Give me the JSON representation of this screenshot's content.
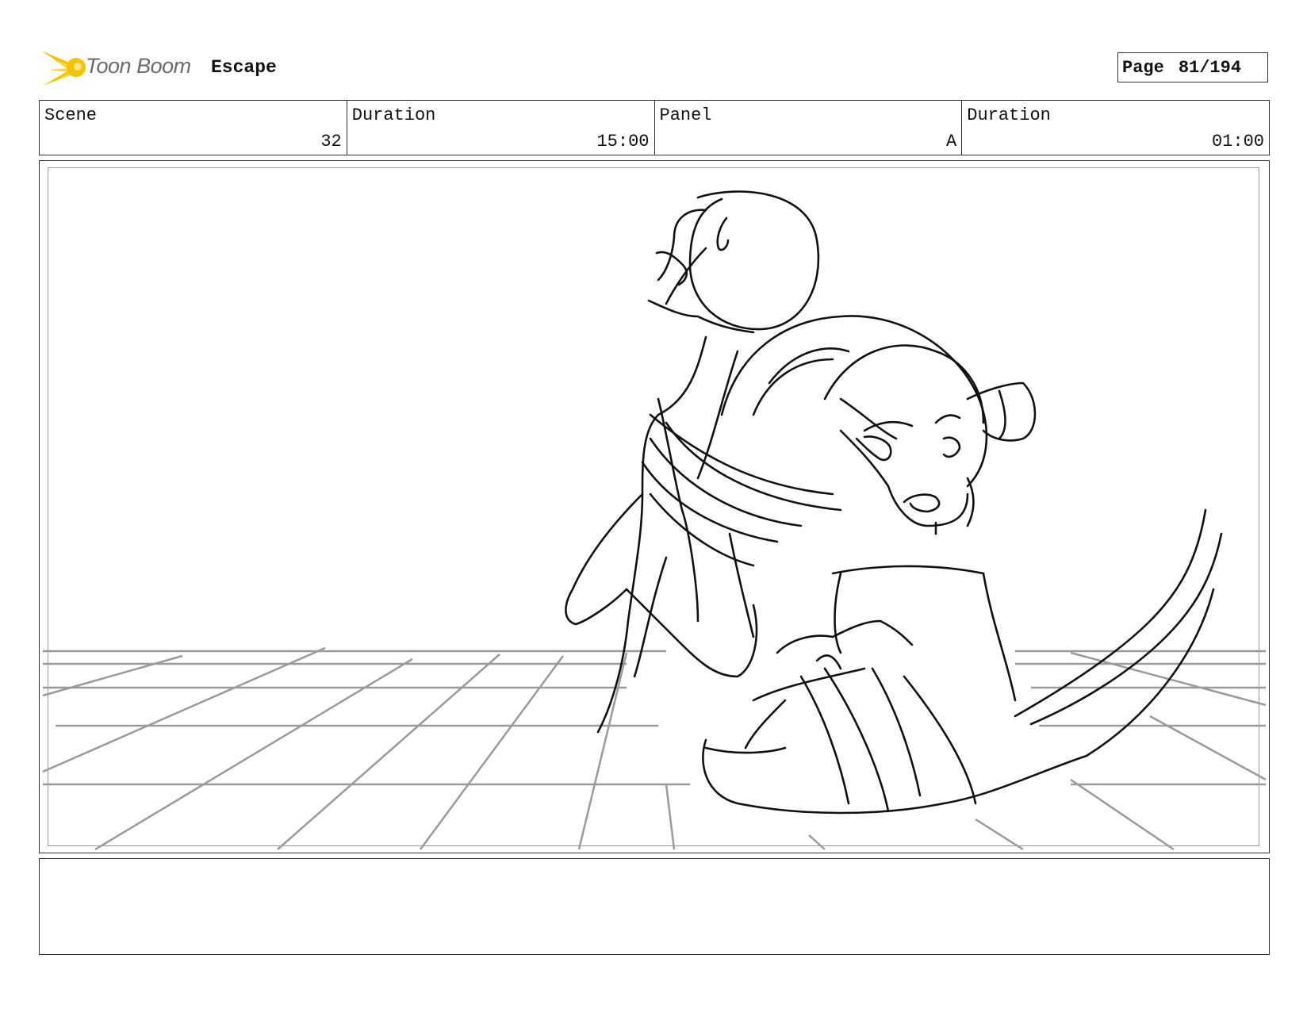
{
  "header": {
    "logo_text": "Toon Boom",
    "project_title": "Escape",
    "page_label": "Page",
    "page_number": "81/194"
  },
  "info": {
    "scene_label": "Scene",
    "scene_value": "32",
    "scene_duration_label": "Duration",
    "scene_duration_value": "15:00",
    "panel_label": "Panel",
    "panel_value": "A",
    "panel_duration_label": "Duration",
    "panel_duration_value": "01:00"
  },
  "notes": {
    "text": ""
  },
  "colors": {
    "logo_yellow": "#f5c400",
    "logo_text": "#6b6b6b",
    "border": "#333333",
    "floor_grid": "#9a9a9a",
    "sketch_line": "#111111"
  }
}
